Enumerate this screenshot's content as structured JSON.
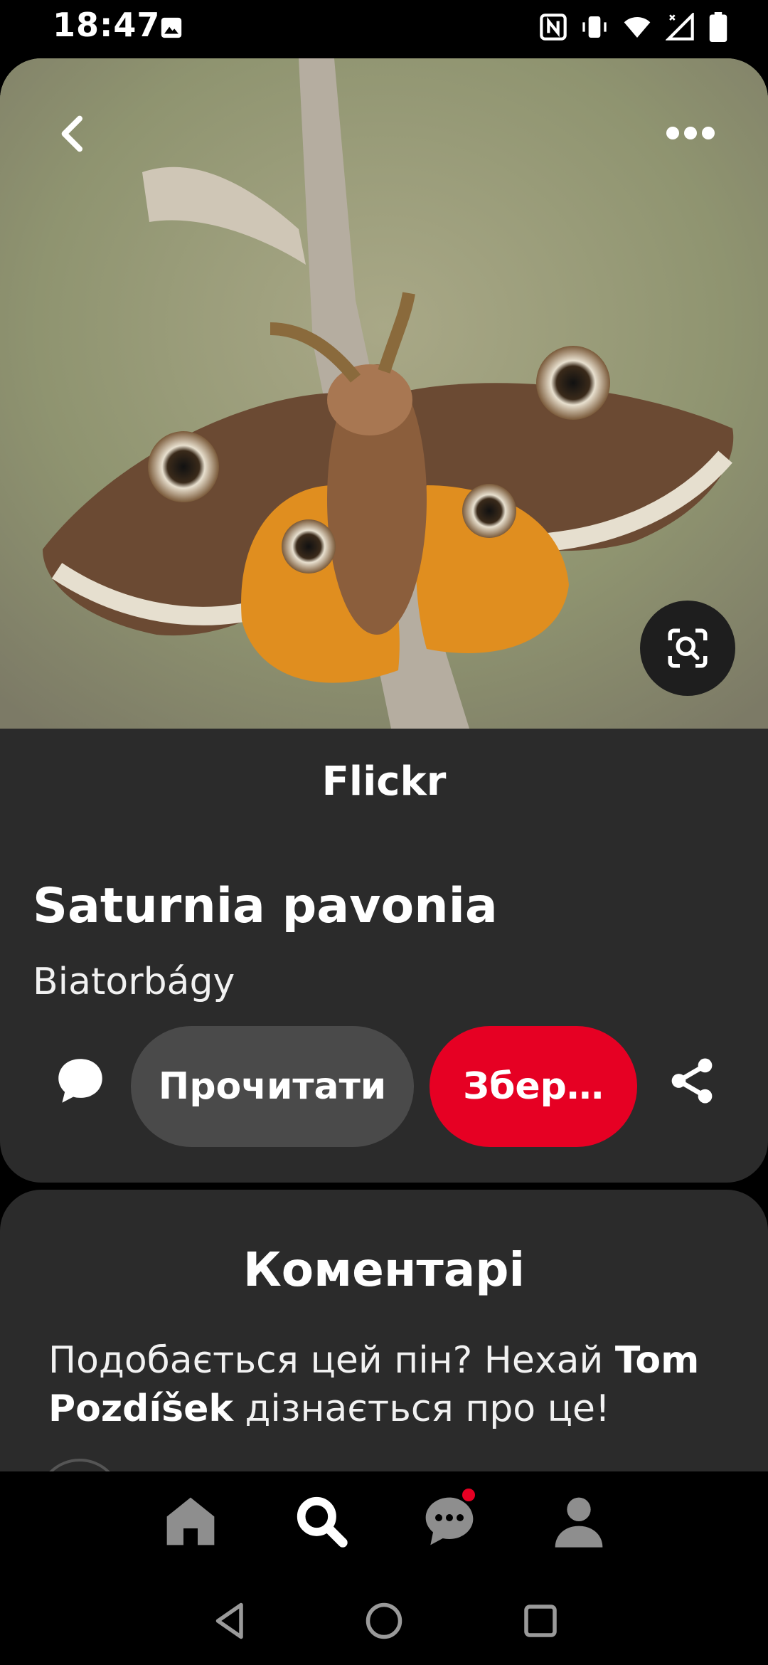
{
  "status_bar": {
    "time": "18:47",
    "icons": [
      "gallery-icon",
      "nfc-icon",
      "vibrate-icon",
      "wifi-icon",
      "signal-icon",
      "battery-icon"
    ]
  },
  "pin": {
    "image_subject": "moth-photo",
    "source": "Flickr",
    "title": "Saturnia pavonia",
    "location": "Biatorbágy",
    "actions": {
      "read_label": "Прочитати",
      "save_label": "Збер…"
    }
  },
  "comments": {
    "title": "Коментарі",
    "prompt_before": "Подобається цей пін? Нехай ",
    "prompt_name": "Tom Pozdíšek",
    "prompt_after": " дізнається про це!"
  },
  "bottom_nav": {
    "items": [
      "home-icon",
      "search-icon",
      "messages-icon",
      "profile-icon"
    ],
    "active": "search-icon",
    "notification": true
  },
  "colors": {
    "accent": "#e60023",
    "card": "#2b2b2b",
    "secondary_button": "#4a4a4a"
  }
}
